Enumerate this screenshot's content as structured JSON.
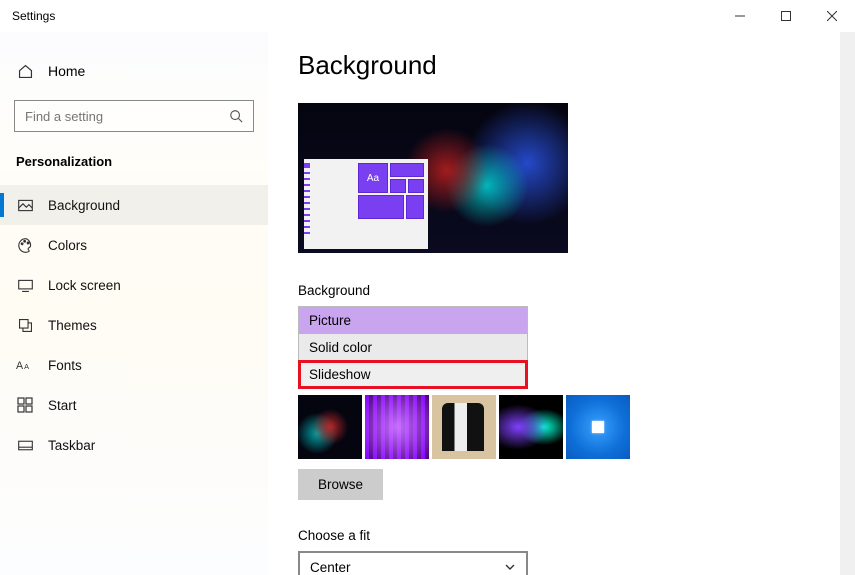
{
  "window": {
    "title": "Settings"
  },
  "sidebar": {
    "home": "Home",
    "search_placeholder": "Find a setting",
    "category": "Personalization",
    "items": [
      {
        "label": "Background"
      },
      {
        "label": "Colors"
      },
      {
        "label": "Lock screen"
      },
      {
        "label": "Themes"
      },
      {
        "label": "Fonts"
      },
      {
        "label": "Start"
      },
      {
        "label": "Taskbar"
      }
    ]
  },
  "main": {
    "heading": "Background",
    "preview_tile": "Aa",
    "bg_label": "Background",
    "bg_options": [
      {
        "label": "Picture"
      },
      {
        "label": "Solid color"
      },
      {
        "label": "Slideshow"
      }
    ],
    "browse": "Browse",
    "fit_label": "Choose a fit",
    "fit_value": "Center"
  }
}
